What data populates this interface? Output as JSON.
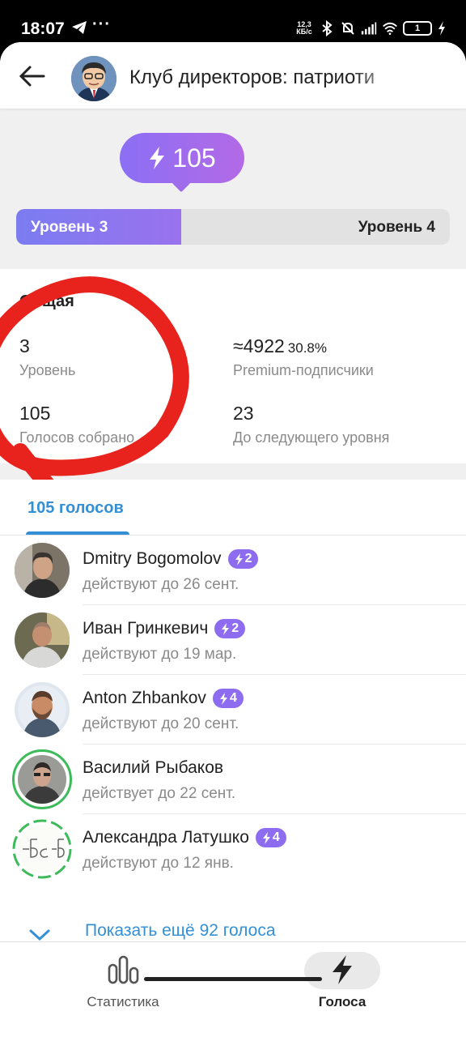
{
  "status_bar": {
    "time": "18:07",
    "more": "···",
    "net_speed_value": "12,3",
    "net_speed_unit": "КБ/с",
    "battery": "1"
  },
  "header": {
    "title": "Клуб директоров: патриоти"
  },
  "boost": {
    "count": "105",
    "current_level_label": "Уровень 3",
    "next_level_label": "Уровень 4",
    "progress_fraction": 0.38
  },
  "overview": {
    "title": "Общая",
    "level_value": "3",
    "level_label": "Уровень",
    "premium_value": "≈4922",
    "premium_percent": "30.8%",
    "premium_label": "Premium-подписчики",
    "boosts_value": "105",
    "boosts_label": "Голосов собрано",
    "next_value": "23",
    "next_label": "До следующего уровня"
  },
  "boosts_tab": {
    "label": "105 голосов"
  },
  "boosters": [
    {
      "name": "Dmitry Bogomolov",
      "badge": "2",
      "expires": "действуют до 26 сент."
    },
    {
      "name": "Иван Гринкевич",
      "badge": "2",
      "expires": "действуют до 19 мар."
    },
    {
      "name": "Anton Zhbankov",
      "badge": "4",
      "expires": "действуют до 20 сент."
    },
    {
      "name": "Василий Рыбаков",
      "badge": "",
      "expires": "действует до 22 сент."
    },
    {
      "name": "Александра Латушко",
      "badge": "4",
      "expires": "действуют до 12 янв."
    }
  ],
  "show_more": {
    "label": "Показать ещё 92 голоса"
  },
  "bottom_nav": {
    "stats_label": "Статистика",
    "boosts_label": "Голоса"
  },
  "colors": {
    "accent_blue": "#3390d6",
    "boost_purple": "#8d6cf0",
    "ring_green": "#3dbb5a"
  }
}
